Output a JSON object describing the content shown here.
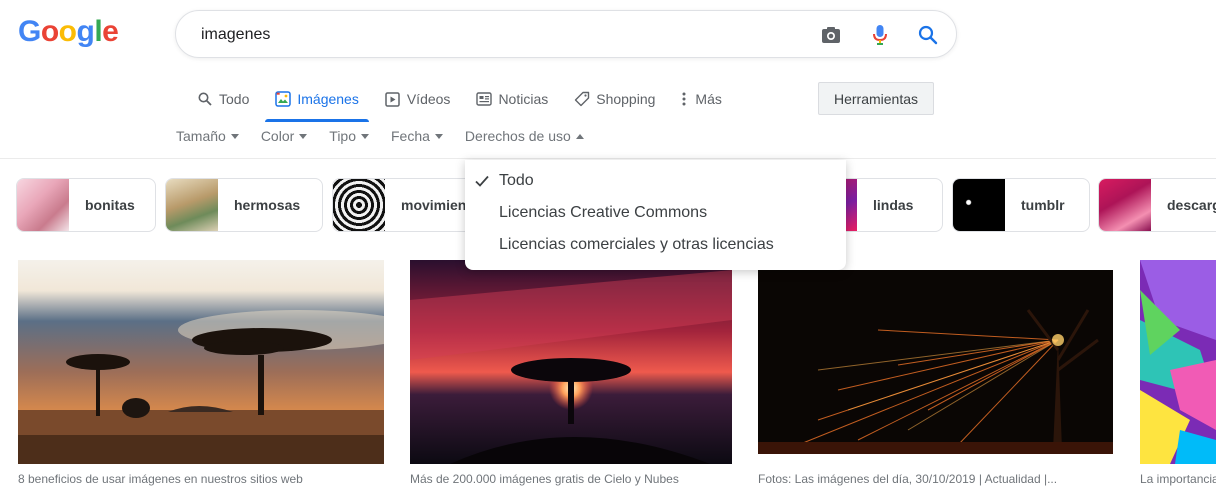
{
  "logo": {
    "letters": [
      {
        "ch": "G",
        "color": "#4285f4"
      },
      {
        "ch": "o",
        "color": "#ea4335"
      },
      {
        "ch": "o",
        "color": "#fbbc05"
      },
      {
        "ch": "g",
        "color": "#4285f4"
      },
      {
        "ch": "l",
        "color": "#34a853"
      },
      {
        "ch": "e",
        "color": "#ea4335"
      }
    ]
  },
  "search": {
    "query": "imagenes",
    "icons": [
      "camera-icon",
      "microphone-icon",
      "search-icon"
    ]
  },
  "tabs": [
    {
      "label": "Todo",
      "icon": "search-icon",
      "active": false
    },
    {
      "label": "Imágenes",
      "icon": "image-icon",
      "active": true
    },
    {
      "label": "Vídeos",
      "icon": "video-icon",
      "active": false
    },
    {
      "label": "Noticias",
      "icon": "news-icon",
      "active": false
    },
    {
      "label": "Shopping",
      "icon": "tag-icon",
      "active": false
    },
    {
      "label": "Más",
      "icon": "more-vert-icon",
      "active": false
    }
  ],
  "tools_label": "Herramientas",
  "filters": [
    {
      "label": "Tamaño",
      "open": false
    },
    {
      "label": "Color",
      "open": false
    },
    {
      "label": "Tipo",
      "open": false
    },
    {
      "label": "Fecha",
      "open": false
    },
    {
      "label": "Derechos de uso",
      "open": true
    }
  ],
  "chips": [
    {
      "label": "bonitas"
    },
    {
      "label": "hermosas"
    },
    {
      "label": "movimiento"
    },
    {
      "label": "lindas"
    },
    {
      "label": "tumblr"
    },
    {
      "label": "descargar"
    }
  ],
  "rights_menu": {
    "items": [
      {
        "label": "Todo",
        "checked": true
      },
      {
        "label": "Licencias Creative Commons",
        "checked": false
      },
      {
        "label": "Licencias comerciales y otras licencias",
        "checked": false
      }
    ]
  },
  "results": [
    {
      "caption": "8 beneficios de usar imágenes en nuestros sitios web"
    },
    {
      "caption": "Más de 200.000 imágenes gratis de Cielo y Nubes"
    },
    {
      "caption": "Fotos: Las imágenes del día, 30/10/2019 | Actualidad |..."
    },
    {
      "caption": "La importancia"
    }
  ],
  "colors": {
    "accent": "#1a73e8",
    "muted": "#70757a",
    "border": "#dfe1e5"
  }
}
